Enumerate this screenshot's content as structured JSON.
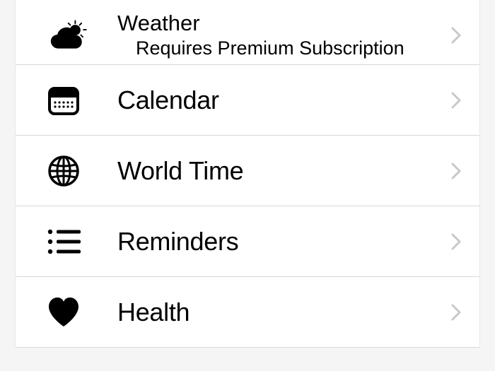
{
  "items": [
    {
      "icon": "weather-icon",
      "title": "Weather",
      "subtitle": "Requires Premium Subscription"
    },
    {
      "icon": "calendar-icon",
      "title": "Calendar"
    },
    {
      "icon": "globe-icon",
      "title": "World Time"
    },
    {
      "icon": "list-icon",
      "title": "Reminders"
    },
    {
      "icon": "heart-icon",
      "title": "Health"
    }
  ]
}
